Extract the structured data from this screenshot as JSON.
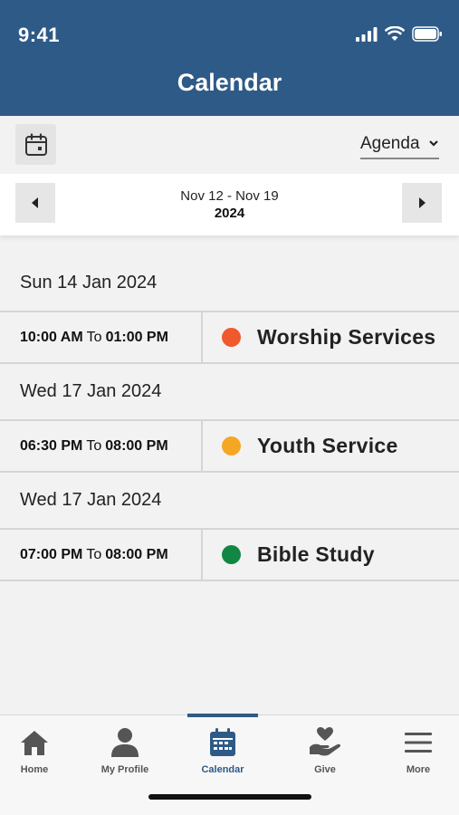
{
  "status_bar": {
    "time": "9:41"
  },
  "header": {
    "title": "Calendar"
  },
  "toolbar": {
    "view_mode": "Agenda"
  },
  "week": {
    "range": "Nov 12 - Nov 19",
    "year": "2024"
  },
  "agenda": [
    {
      "date": "Sun 14 Jan 2024",
      "start": "10:00 AM",
      "to": "To",
      "end": "01:00 PM",
      "title": "Worship Services",
      "color": "#f0592b"
    },
    {
      "date": "Wed 17 Jan 2024",
      "start": "06:30 PM",
      "to": "To",
      "end": "08:00 PM",
      "title": "Youth Service",
      "color": "#f5a623"
    },
    {
      "date": "Wed 17 Jan 2024",
      "start": "07:00 PM",
      "to": "To",
      "end": "08:00 PM",
      "title": "Bible Study",
      "color": "#128743"
    }
  ],
  "tabs": [
    {
      "label": "Home",
      "icon": "home-icon"
    },
    {
      "label": "My Profile",
      "icon": "profile-icon"
    },
    {
      "label": "Calendar",
      "icon": "calendar-icon",
      "active": true
    },
    {
      "label": "Give",
      "icon": "give-icon"
    },
    {
      "label": "More",
      "icon": "menu-icon"
    }
  ],
  "colors": {
    "primary": "#2e5a87",
    "background": "#f2f2f2"
  }
}
